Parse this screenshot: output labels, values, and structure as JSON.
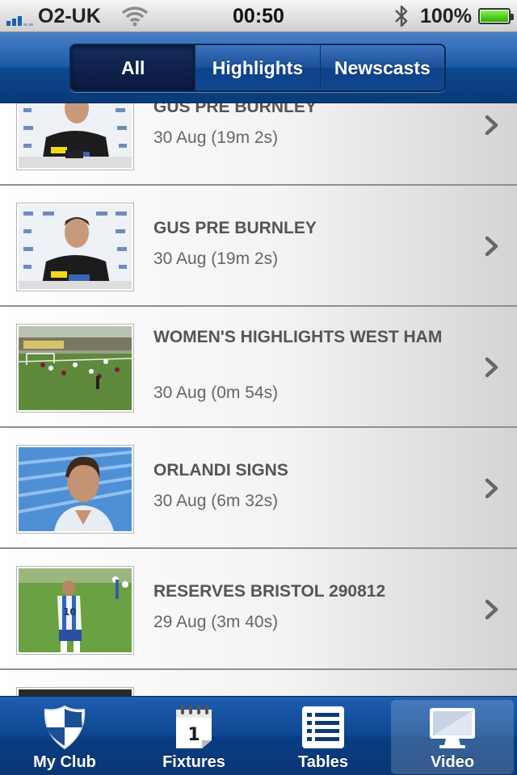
{
  "status_bar": {
    "carrier": "O2-UK",
    "time": "00:50",
    "battery_percent": "100%",
    "signal_icon": "signal-bars-icon",
    "wifi_icon": "wifi-icon",
    "bluetooth_icon": "bluetooth-icon"
  },
  "segmented_control": {
    "segments": [
      {
        "label": "All",
        "selected": true
      },
      {
        "label": "Highlights",
        "selected": false
      },
      {
        "label": "Newscasts",
        "selected": false
      }
    ]
  },
  "videos": [
    {
      "title": "GUS PRE BURNLEY",
      "meta": "30 Aug (19m 2s)",
      "thumb": "press-conference"
    },
    {
      "title": "GUS PRE BURNLEY",
      "meta": "30 Aug (19m 2s)",
      "thumb": "press-conference"
    },
    {
      "title": "WOMEN'S HIGHLIGHTS WEST HAM",
      "meta": "30 Aug (0m 54s)",
      "thumb": "football-pitch"
    },
    {
      "title": "ORLANDI SIGNS",
      "meta": "30 Aug (6m 32s)",
      "thumb": "player-interview"
    },
    {
      "title": "RESERVES BRISTOL 290812",
      "meta": "29 Aug (3m 40s)",
      "thumb": "player-on-pitch"
    },
    {
      "title": "",
      "meta": "",
      "thumb": "dark"
    }
  ],
  "tab_bar": {
    "tabs": [
      {
        "label": "My Club",
        "icon": "shield-icon",
        "selected": false
      },
      {
        "label": "Fixtures",
        "icon": "calendar-icon",
        "selected": false
      },
      {
        "label": "Tables",
        "icon": "list-icon",
        "selected": false
      },
      {
        "label": "Video",
        "icon": "monitor-icon",
        "selected": true
      }
    ]
  },
  "colors": {
    "nav_blue": "#0c4790",
    "battery_green": "#29b000",
    "title_gray": "#555555"
  }
}
